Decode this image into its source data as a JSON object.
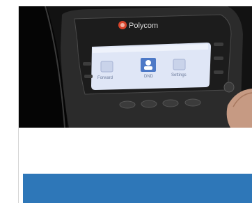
{
  "photo": {
    "brand_text": "Polycom",
    "screen_items": [
      {
        "label": "Forward"
      },
      {
        "label": "DND"
      },
      {
        "label": "Settings"
      }
    ],
    "colors": {
      "band": "#2e77b8",
      "screen": "#dfe6f6",
      "body": "#2a2a2a",
      "logo": "#d8442b"
    }
  }
}
